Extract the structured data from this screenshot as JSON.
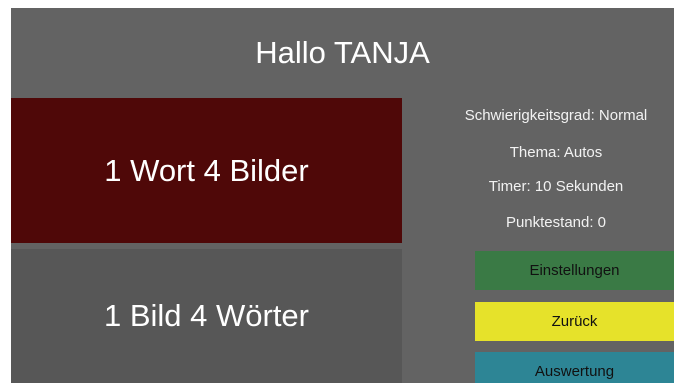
{
  "header": {
    "greeting": "Hallo TANJA"
  },
  "games": {
    "word_game": "1 Wort 4 Bilder",
    "picture_game": "1 Bild 4 Wörter"
  },
  "info": {
    "difficulty": "Schwierigkeitsgrad: Normal",
    "topic": "Thema: Autos",
    "timer": "Timer: 10 Sekunden",
    "score": "Punktestand: 0"
  },
  "buttons": {
    "settings": "Einstellungen",
    "back": "Zurück",
    "evaluation": "Auswertung"
  },
  "colors": {
    "background": "#636363",
    "selected_tile": "#4f0808",
    "unselected_tile": "#575757",
    "settings_button": "#3a7a45",
    "back_button": "#e6e22a",
    "evaluation_button": "#2d8595"
  }
}
